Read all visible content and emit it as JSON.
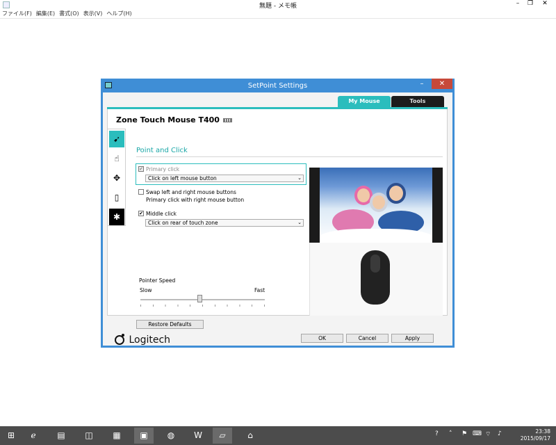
{
  "notepad": {
    "title": "無題 - メモ帳",
    "menu": [
      "ファイル(F)",
      "編集(E)",
      "書式(O)",
      "表示(V)",
      "ヘルプ(H)"
    ],
    "controls": {
      "minimize": "–",
      "restore": "❐",
      "close": "✕"
    }
  },
  "dialog": {
    "title": "SetPoint Settings",
    "minimize": "–",
    "close": "✕",
    "tabs": [
      "My Mouse",
      "Tools"
    ],
    "device_name": "Zone Touch Mouse T400",
    "section_title": "Point and Click",
    "primary_click": {
      "label": "Primary click",
      "checked": true,
      "value": "Click on left mouse button"
    },
    "swap": {
      "label": "Swap left and right mouse buttons",
      "checked": false,
      "sublabel": "Primary click with right mouse button"
    },
    "middle_click": {
      "label": "Middle click",
      "checked": true,
      "value": "Click on rear of touch zone"
    },
    "pointer_speed": {
      "label": "Pointer Speed",
      "slow": "Slow",
      "fast": "Fast",
      "level": 0.48
    },
    "buttons": {
      "restore": "Restore Defaults",
      "ok": "OK",
      "cancel": "Cancel",
      "apply": "Apply"
    },
    "brand": "Logitech",
    "side_icons": [
      "pointer-click-icon",
      "hand-icon",
      "move-arrows-icon",
      "battery-icon",
      "snowflake-icon"
    ],
    "colors": {
      "accent": "#2bbdbd",
      "titlebar": "#3f8ed6",
      "close": "#c7493a"
    }
  },
  "taskbar": {
    "apps": [
      "windows-icon",
      "ie-icon",
      "explorer-icon",
      "store-icon",
      "folder-icon",
      "setpoint-icon",
      "network-icon",
      "word-icon",
      "notepad-icon",
      "home-icon"
    ],
    "clock_time": "23:38",
    "clock_date": "2015/09/17"
  }
}
